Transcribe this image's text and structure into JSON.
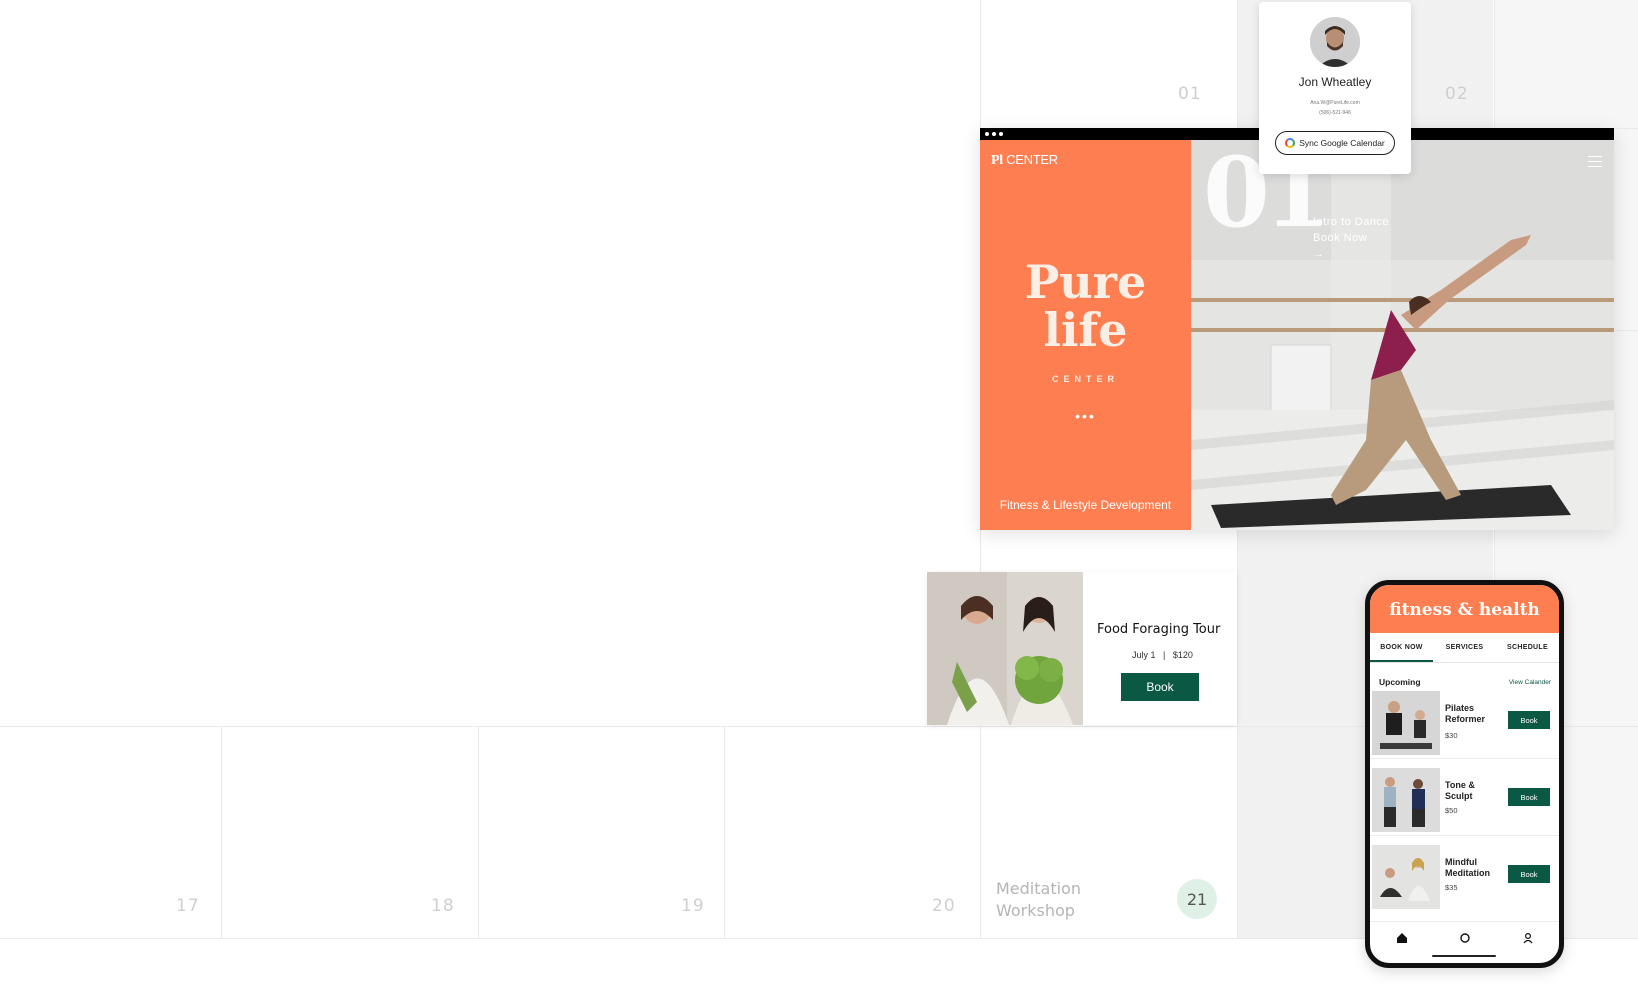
{
  "calendar": {
    "day_numbers": [
      "01",
      "02",
      "17",
      "18",
      "19",
      "20",
      "21"
    ],
    "event": {
      "title": "Meditation Workshop"
    }
  },
  "profile": {
    "name": "Jon Wheatley",
    "email": "Ana.W@PureLife.com",
    "phone": "(506)-521-946",
    "sync_label": "Sync Google Calendar"
  },
  "website": {
    "logo_mark": "Pl",
    "logo_text": "CENTER",
    "hero_title_line1": "Pure",
    "hero_title_line2": "life",
    "hero_sub": "CENTER",
    "hero_dots": "•••",
    "tagline": "Fitness & Lifestyle Development",
    "big_number": "01",
    "intro_line1": "Intro to Dance",
    "intro_line2": "Book Now",
    "arrow": "→"
  },
  "food_card": {
    "title": "Food Foraging Tour",
    "date": "July 1",
    "separator": "|",
    "price": "$120",
    "book_label": "Book"
  },
  "phone": {
    "header": "fitness & health",
    "tabs": [
      "BOOK NOW",
      "SERVICES",
      "SCHEDULE"
    ],
    "upcoming_label": "Upcoming",
    "view_calendar": "View Calander",
    "classes": [
      {
        "name": "Pilates Reformer",
        "price": "$30",
        "book": "Book"
      },
      {
        "name": "Tone & Sculpt",
        "price": "$50",
        "book": "Book"
      },
      {
        "name": "Mindful Meditation",
        "price": "$35",
        "book": "Book"
      }
    ]
  },
  "colors": {
    "brand_orange": "#fd7f51",
    "brand_green": "#0b5845",
    "highlight_mint": "#dff0e6"
  },
  "icons": [
    "google-icon",
    "menu-icon",
    "home-icon",
    "search-icon",
    "profile-icon",
    "window-dots-icon"
  ]
}
